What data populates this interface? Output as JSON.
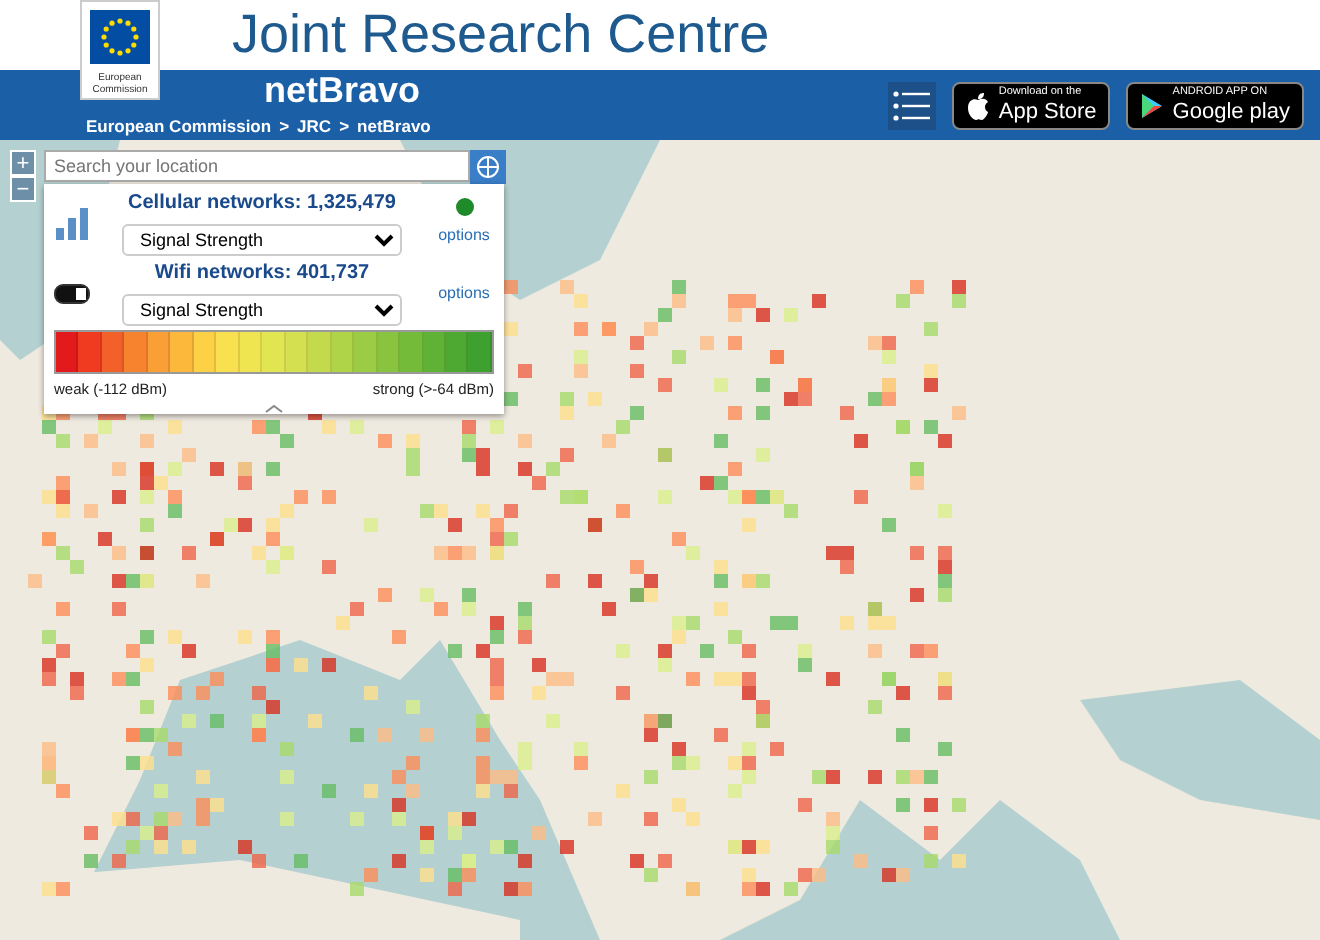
{
  "header": {
    "logo_text": "European Commission",
    "title": "Joint Research Centre",
    "app_name": "netBravo",
    "breadcrumb": [
      "European Commission",
      "JRC",
      "netBravo"
    ],
    "breadcrumb_separator": ">",
    "store_buttons": [
      {
        "kind": "apple",
        "small": "Download on the",
        "big": "App Store"
      },
      {
        "kind": "google",
        "small": "ANDROID APP ON",
        "big": "Google play"
      }
    ]
  },
  "map": {
    "zoom_controls": [
      "+",
      "−"
    ],
    "search": {
      "placeholder": "Search your location"
    }
  },
  "panel": {
    "sections": [
      {
        "kind": "cellular",
        "title": "Cellular networks: 1,325,479",
        "select": "Signal Strength",
        "link": "options"
      },
      {
        "kind": "wifi",
        "title": "Wifi networks: 401,737",
        "select": "Signal Strength",
        "link": "options"
      }
    ],
    "legend": {
      "weak": "weak (-112 dBm)",
      "strong": "strong (>-64 dBm)"
    }
  }
}
